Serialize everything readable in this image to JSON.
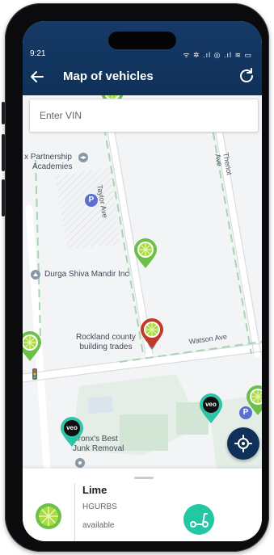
{
  "status_bar": {
    "time": "9:21",
    "indicators": "ᯤ ✲ .ıl ◎ .ıl ≋ ▭"
  },
  "header": {
    "title": "Map of vehicles",
    "back_icon": "back-arrow-icon",
    "refresh_icon": "refresh-icon",
    "background": "#0f3159"
  },
  "search": {
    "placeholder": "Enter VIN",
    "value": ""
  },
  "map": {
    "places": {
      "partnership": "x Partnership",
      "academies": "Academies",
      "temple": "Durga Shiva Mandir Inc",
      "trades_1": "Rockland county",
      "trades_2": "building trades",
      "bronx_1": "Bronx's Best",
      "bronx_2": "Junk Removal"
    },
    "streets": {
      "taylor": "Taylor Ave",
      "theriot": "Theriot Ave",
      "watson": "Watson Ave"
    },
    "parking_label": "P",
    "markers": [
      {
        "brand": "lime",
        "label": "lime",
        "color": "#6cc04a"
      },
      {
        "brand": "lime",
        "label": "lime",
        "color": "#6cc04a"
      },
      {
        "brand": "lime",
        "label": "lime",
        "color": "#6cc04a"
      },
      {
        "brand": "lime",
        "label": "lime-selected",
        "color": "#c0392b"
      },
      {
        "brand": "lime",
        "label": "lime",
        "color": "#6cc04a"
      },
      {
        "brand": "veo",
        "label": "veo",
        "color": "#2fc3a7"
      },
      {
        "brand": "veo",
        "label": "veo",
        "color": "#2fc3a7"
      }
    ],
    "veo_text": "veo"
  },
  "locate_button": {
    "icon": "my-location-icon"
  },
  "vehicle_card": {
    "name": "Lime",
    "code": "HGURBS",
    "status": "available",
    "logo_icon": "lime-logo-icon",
    "type_icon": "scooter-icon",
    "type_color": "#22c7a4"
  }
}
